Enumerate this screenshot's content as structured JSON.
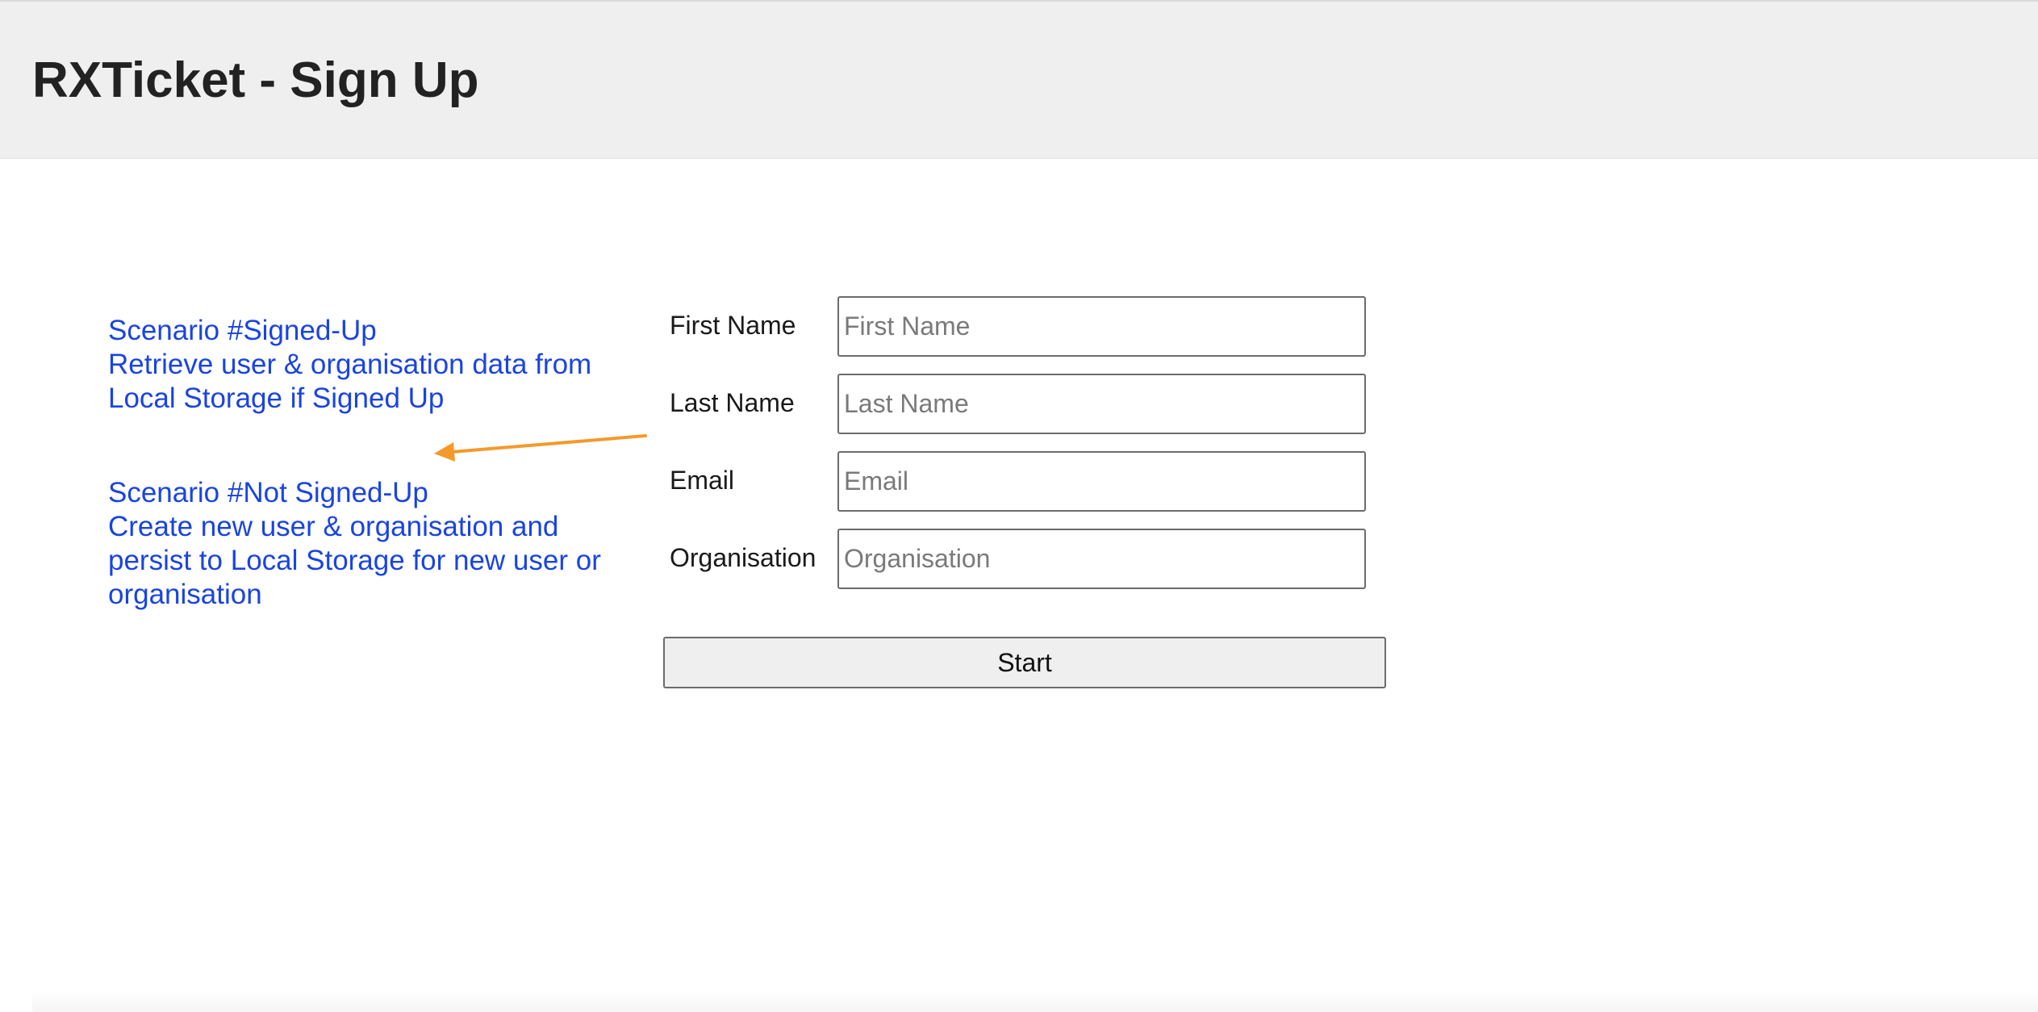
{
  "header": {
    "title": "RXTicket - Sign Up",
    "background_color": "#efefef"
  },
  "annotations": {
    "signed_up": {
      "lines": [
        "Scenario #Signed-Up",
        "Retrieve user & organisation data from",
        "Local Storage if Signed Up"
      ]
    },
    "not_signed_up": {
      "lines": [
        "Scenario #Not Signed-Up",
        "Create new user & organisation and",
        "persist to Local Storage for new user or",
        "organisation"
      ]
    },
    "text_color": "#1a44e0",
    "arrow_color": "#f39a2b"
  },
  "form": {
    "fields": [
      {
        "label": "First Name",
        "placeholder": "First Name",
        "value": ""
      },
      {
        "label": "Last Name",
        "placeholder": "Last Name",
        "value": ""
      },
      {
        "label": "Email",
        "placeholder": "Email",
        "value": ""
      },
      {
        "label": "Organisation",
        "placeholder": "Organisation",
        "value": ""
      }
    ],
    "submit_label": "Start"
  }
}
